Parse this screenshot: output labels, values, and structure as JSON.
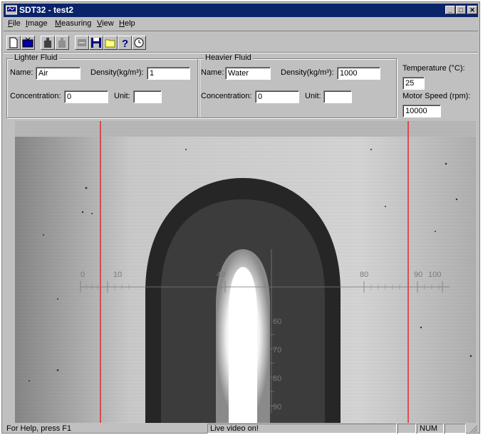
{
  "window": {
    "title": "SDT32 - test2"
  },
  "menu": [
    "File",
    "Image",
    "Measuring",
    "View",
    "Help"
  ],
  "menu_underline": [
    "F",
    "I",
    "M",
    "V",
    "H"
  ],
  "lighter": {
    "legend": "Lighter Fluid",
    "name_label": "Name:",
    "name_value": "Air",
    "density_label": "Density(kg/m³):",
    "density_value": "1",
    "conc_label": "Concentration:",
    "conc_value": "0",
    "unit_label": "Unit:",
    "unit_value": ""
  },
  "heavier": {
    "legend": "Heavier Fluid",
    "name_label": "Name:",
    "name_value": "Water",
    "density_label": "Density(kg/m³):",
    "density_value": "1000",
    "conc_label": "Concentration:",
    "conc_value": "0",
    "unit_label": "Unit:",
    "unit_value": ""
  },
  "temperature": {
    "label": "Temperature (°C):",
    "value": "25"
  },
  "motor": {
    "label": "Motor Speed (rpm):",
    "value": "10000"
  },
  "video": {
    "scale_h_labels": [
      "0",
      "10",
      "40",
      "80",
      "90",
      "100"
    ],
    "scale_v_labels": [
      "60",
      "70",
      "80",
      "90"
    ]
  },
  "status": {
    "help": "For Help, press F1",
    "live": "Live video on!",
    "num": "NUM"
  }
}
